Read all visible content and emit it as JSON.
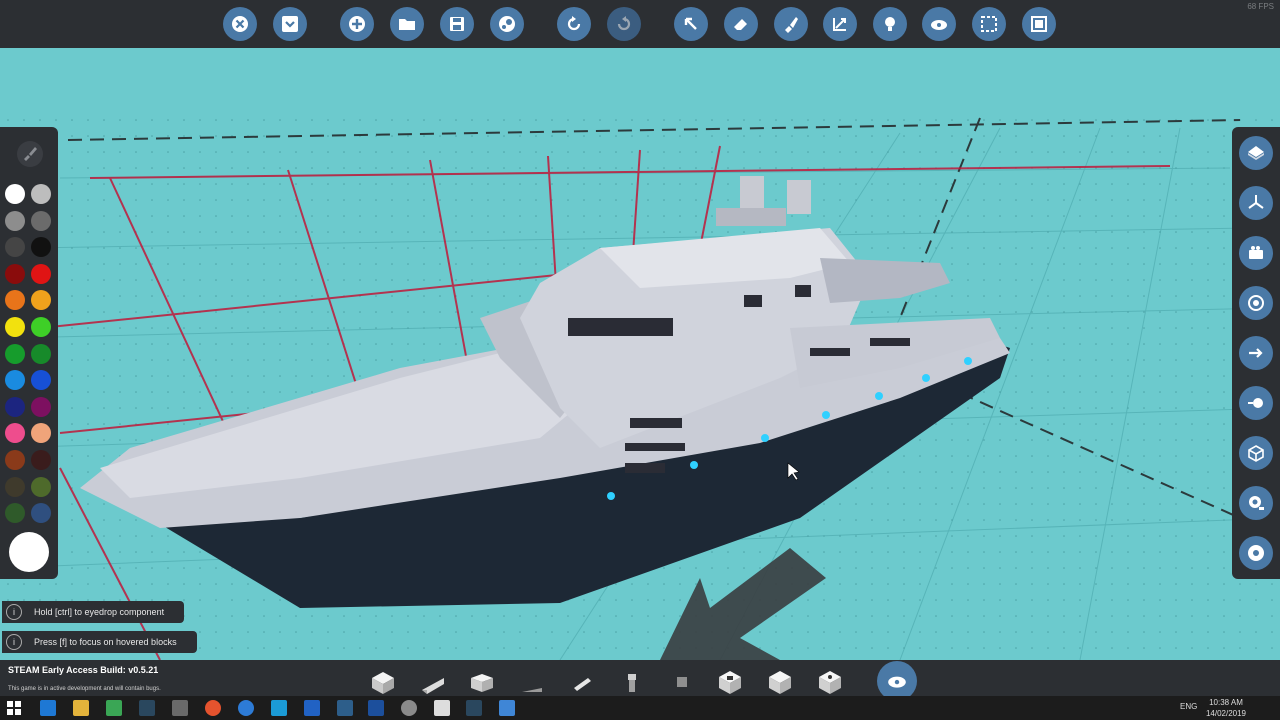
{
  "fps": "68 FPS",
  "toolbar": {
    "buttons": [
      {
        "name": "close-button",
        "icon": "close-icon"
      },
      {
        "name": "dropdown-button",
        "icon": "chevron-down-icon"
      },
      {
        "name": "new-button",
        "icon": "plus-icon"
      },
      {
        "name": "open-button",
        "icon": "folder-icon"
      },
      {
        "name": "save-button",
        "icon": "save-icon"
      },
      {
        "name": "workshop-button",
        "icon": "steam-icon"
      },
      {
        "name": "undo-button",
        "icon": "undo-icon"
      },
      {
        "name": "redo-button",
        "icon": "redo-icon"
      },
      {
        "name": "select-tool-button",
        "icon": "cursor-icon"
      },
      {
        "name": "eraser-tool-button",
        "icon": "eraser-icon"
      },
      {
        "name": "paint-tool-button",
        "icon": "paint-icon"
      },
      {
        "name": "scale-tool-button",
        "icon": "scale-icon"
      },
      {
        "name": "light-tool-button",
        "icon": "lightbulb-icon"
      },
      {
        "name": "logic-tool-button",
        "icon": "logic-icon"
      },
      {
        "name": "area-select-button",
        "icon": "dashed-square-icon"
      },
      {
        "name": "fullscreen-button",
        "icon": "fit-icon"
      }
    ]
  },
  "palette": {
    "colors": [
      "#ffffff",
      "#bdbdbd",
      "#8d8d8d",
      "#6b6b6b",
      "#454545",
      "#111111",
      "#8a0c0c",
      "#e01414",
      "#e8741a",
      "#f0a21c",
      "#f2e10e",
      "#3ecf27",
      "#169c2c",
      "#178a2a",
      "#1a8be0",
      "#1750d6",
      "#1c2580",
      "#7d1060",
      "#ee4d8d",
      "#f0a47a",
      "#8a3a1a",
      "#3a1c1c",
      "#3f3a2c",
      "#4e6a2b",
      "#2f5a2a",
      "#2f4f7f"
    ],
    "selected": "#ffffff"
  },
  "rightbar": {
    "buttons": [
      "view-top-icon",
      "view-iso-icon",
      "camera-icon",
      "focus-icon",
      "arrow-right-icon",
      "toggle-icon",
      "cube-icon",
      "screenshot-icon",
      "help-icon"
    ]
  },
  "hints": [
    {
      "text": "Hold [ctrl] to eyedrop component"
    },
    {
      "text": "Press [f] to focus on hovered blocks"
    }
  ],
  "bottom": {
    "build": "STEAM Early Access Build: v0.5.21",
    "note": "This game is in active development and will contain bugs."
  },
  "taskbar": {
    "lang": "ENG",
    "time": "10:38 AM",
    "date": "14/02/2019"
  }
}
